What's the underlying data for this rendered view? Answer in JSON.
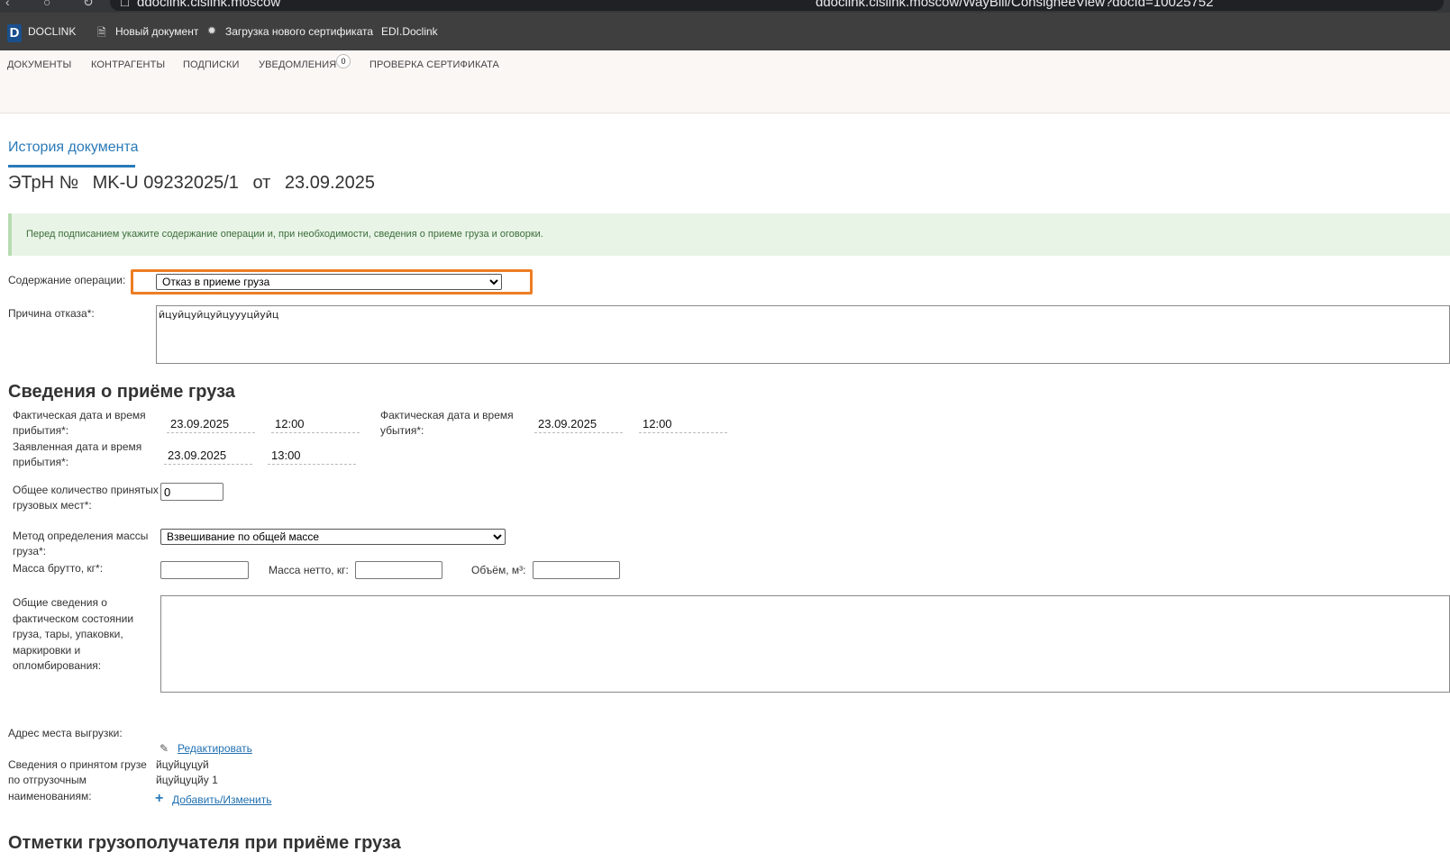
{
  "browser": {
    "url_left": "ddoclink.cislink.moscow",
    "url_center": "ddoclink.cislink.moscow/WayBill/ConsigneeView?docId=10025752"
  },
  "topbar": {
    "logo_letter": "D",
    "brand": "DOCLINK",
    "new_document": "Новый документ",
    "upload_certificate": "Загрузка нового сертификата",
    "edi_link": "EDI.Doclink"
  },
  "menu": {
    "documents": "ДОКУМЕНТЫ",
    "counterparties": "КОНТРАГЕНТЫ",
    "subscriptions": "ПОДПИСКИ",
    "notifications": "УВЕДОМЛЕНИЯ",
    "notifications_count": "0",
    "check_certificate": "ПРОВЕРКА СЕРТИФИКАТА"
  },
  "tabs": {
    "history": "История документа"
  },
  "document": {
    "type_label": "ЭТрН №",
    "number": "MK-U 09232025/1",
    "from_label": "от",
    "date": "23.09.2025"
  },
  "alert": {
    "text": "Перед подписанием укажите содержание операции и, при необходимости, сведения о приеме груза и оговорки."
  },
  "operation": {
    "label": "Содержание операции:",
    "selected": "Отказ в приеме груза"
  },
  "refusal": {
    "label": "Причина отказа*:",
    "value": "йцуйцуйцуйцуууцйуйц"
  },
  "cargo_section": {
    "title": "Сведения о приёме груза",
    "actual_arrival_label_1": "Фактическая дата и время",
    "actual_arrival_label_2": "прибытия*:",
    "actual_arrival_date": "23.09.2025",
    "actual_arrival_time": "12:00",
    "actual_departure_label_1": "Фактическая дата и время",
    "actual_departure_label_2": "убытия*:",
    "actual_departure_date": "23.09.2025",
    "actual_departure_time": "12:00",
    "declared_arrival_label_1": "Заявленная дата и время",
    "declared_arrival_label_2": "прибытия*:",
    "declared_arrival_date": "23.09.2025",
    "declared_arrival_time": "13:00",
    "places_label_1": "Общее количество принятых",
    "places_label_2": "грузовых мест*:",
    "places_value": "0",
    "mass_method_label_1": "Метод определения массы",
    "mass_method_label_2": "груза*:",
    "mass_method_selected": "Взвешивание по общей массе",
    "gross_label": "Масса брутто, кг*:",
    "net_label": "Масса нетто, кг:",
    "volume_label": "Объём, м³:",
    "condition_label_1": "Общие сведения о",
    "condition_label_2": "фактическом состоянии",
    "condition_label_3": "груза, тары, упаковки,",
    "condition_label_4": "маркировки и",
    "condition_label_5": "опломбирования:",
    "condition_value": ""
  },
  "unloading": {
    "label": "Адрес места выгрузки:",
    "edit_link": "Редактировать"
  },
  "accepted_goods": {
    "label_1": "Сведения о принятом грузе",
    "label_2": "по отгрузочным",
    "label_3": "наименованиям:",
    "item_1": "йцуйцуцуй",
    "item_2": "йцуйцуцйу 1",
    "add_link": "Добавить/Изменить"
  },
  "next_section": {
    "title": "Отметки грузополучателя при приёме груза"
  }
}
